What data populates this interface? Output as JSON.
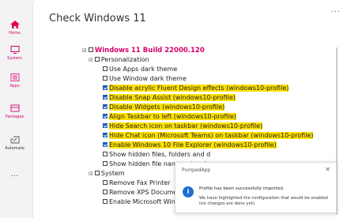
{
  "nav": {
    "home": "Home",
    "system": "System",
    "apps": "Apps",
    "packages": "Packages",
    "automate": "Automate",
    "more": "···",
    "accent": "#d6006f",
    "active": "#e0005b"
  },
  "page": {
    "title": "Check Windows 11",
    "menu": "···"
  },
  "tree": {
    "root": {
      "expander": "⊟",
      "label": "Windows 11 Build 22000.120"
    },
    "personalization": {
      "expander": "⊟",
      "label": "Personalization"
    },
    "items": [
      {
        "label": "Use Apps dark theme",
        "checked": false,
        "highlight": false
      },
      {
        "label": "Use Window dark theme",
        "checked": false,
        "highlight": false
      },
      {
        "label": "Disable acrylic Fluent Design effects (windows10-profile)",
        "checked": true,
        "highlight": true
      },
      {
        "label": "Disable Snap Assist (windows10-profile)",
        "checked": true,
        "highlight": true
      },
      {
        "label": "Disable Widgets (windows10-profile)",
        "checked": true,
        "highlight": true
      },
      {
        "label": "Align Taskbar to left (windows10-profile)",
        "checked": true,
        "highlight": true
      },
      {
        "label": "Hide Search icon on taskbar (windows10-profile)",
        "checked": true,
        "highlight": true
      },
      {
        "label": "Hide Chat icon (Microsoft Teams) on taskbar (windows10-profile)",
        "checked": true,
        "highlight": true
      },
      {
        "label": "Enable Windows 10 File Explorer (windows10-profile)",
        "checked": true,
        "highlight": true
      },
      {
        "label": "Show hidden files, folders and d",
        "checked": false,
        "highlight": false
      },
      {
        "label": "Show hidden file name extension",
        "checked": false,
        "highlight": false
      }
    ],
    "system": {
      "expander": "⊟",
      "label": "System"
    },
    "system_items": [
      {
        "label": "Remove Fax Printer",
        "checked": false
      },
      {
        "label": "Remove XPS Documents Writer",
        "checked": false
      },
      {
        "label": "Enable Microsoft Windows Subs",
        "checked": false
      }
    ]
  },
  "toast": {
    "title": "PumpedApp",
    "close": "✕",
    "icon": "i",
    "message": "Profile has been successfully imported.",
    "sub": "We have highlighted the configuration that would be enabled (no changes are done yet)."
  }
}
